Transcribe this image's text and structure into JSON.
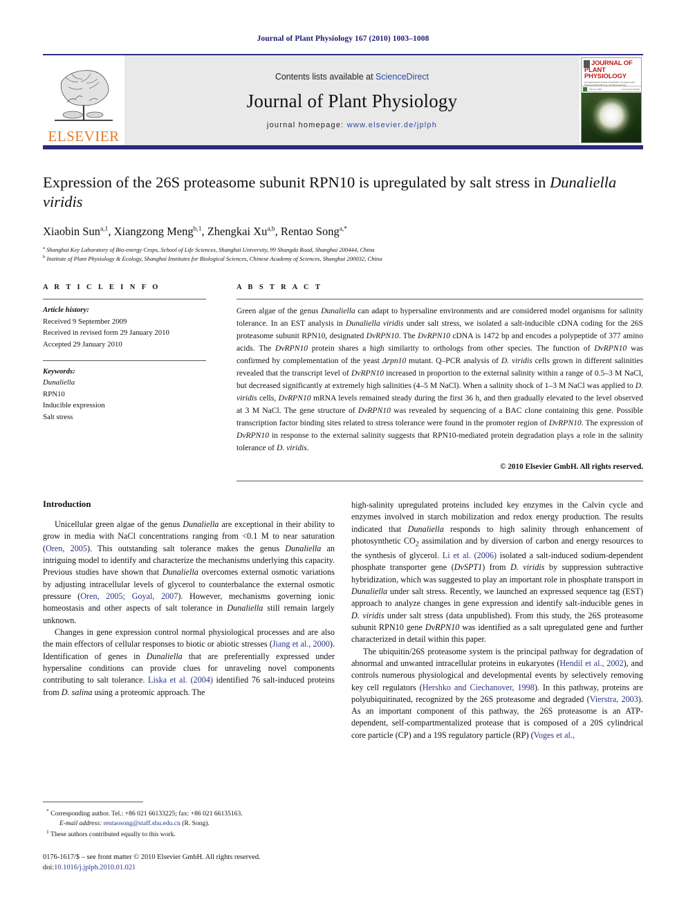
{
  "running_head": "Journal of Plant Physiology 167 (2010) 1003–1008",
  "masthead": {
    "publisher_name": "ELSEVIER",
    "publisher_logo_icon": "elsevier-tree-icon",
    "contents_prefix": "Contents lists available at ",
    "contents_link": "ScienceDirect",
    "journal_title": "Journal of Plant Physiology",
    "homepage_prefix": "journal homepage: ",
    "homepage_url": "www.elsevier.de/jplph",
    "cover": {
      "line1": "JOURNAL OF",
      "line2": "PLANT PHYSIOLOGY",
      "subline": "An International Journal of Scientific, Ecological and Functional Plant Biology and Biotechnology",
      "bar_left": "Editor-in-Chief",
      "bar_right": "www.elsevier.de/jplph",
      "image_icon": "dandelion-photo-icon"
    },
    "rule_color": "#2b2b7a"
  },
  "article": {
    "title_line1": "Expression of the 26S proteasome subunit RPN10 is upregulated by salt stress in",
    "title_italic": "Dunaliella viridis",
    "authors": [
      {
        "name": "Xiaobin Sun",
        "sup": "a,1",
        "sep": ", "
      },
      {
        "name": "Xiangzong Meng",
        "sup": "b,1",
        "sep": ", "
      },
      {
        "name": "Zhengkai Xu",
        "sup": "a,b",
        "sep": ", "
      },
      {
        "name": "Rentao Song",
        "sup": "a,*",
        "sep": ""
      }
    ],
    "affiliations": [
      {
        "marker": "a",
        "text": "Shanghai Key Laboratory of Bio-energy Crops, School of Life Sciences, Shanghai University, 99 Shangda Road, Shanghai 200444, China"
      },
      {
        "marker": "b",
        "text": "Institute of Plant Physiology & Ecology, Shanghai Institutes for Biological Sciences, Chinese Academy of Sciences, Shanghai 200032, China"
      }
    ]
  },
  "article_info": {
    "heading": "A R T I C L E    I N F O",
    "history_label": "Article history:",
    "history": [
      "Received 9 September 2009",
      "Received in revised form 29 January 2010",
      "Accepted 29 January 2010"
    ],
    "keywords_label": "Keywords:",
    "keywords": [
      {
        "text": "Dunaliella",
        "italic": true
      },
      {
        "text": "RPN10",
        "italic": false
      },
      {
        "text": "Inducible expression",
        "italic": false
      },
      {
        "text": "Salt stress",
        "italic": false
      }
    ]
  },
  "abstract": {
    "heading": "A B S T R A C T",
    "text": "Green algae of the genus Dunaliella can adapt to hypersaline environments and are considered model organisms for salinity tolerance. In an EST analysis in Dunaliella viridis under salt stress, we isolated a salt-inducible cDNA coding for the 26S proteasome subunit RPN10, designated DvRPN10. The DvRPN10 cDNA is 1472 bp and encodes a polypeptide of 377 amino acids. The DvRPN10 protein shares a high similarity to orthologs from other species. The function of DvRPN10 was confirmed by complementation of the yeast Δrpn10 mutant. Q–PCR analysis of D. viridis cells grown in different salinities revealed that the transcript level of DvRPN10 increased in proportion to the external salinity within a range of 0.5–3 M NaCl, but decreased significantly at extremely high salinities (4–5 M NaCl). When a salinity shock of 1–3 M NaCl was applied to D. viridis cells, DvRPN10 mRNA levels remained steady during the first 36 h, and then gradually elevated to the level observed at 3 M NaCl. The gene structure of DvRPN10 was revealed by sequencing of a BAC clone containing this gene. Possible transcription factor binding sites related to stress tolerance were found in the promoter region of DvRPN10. The expression of DvRPN10 in response to the external salinity suggests that RPN10-mediated protein degradation plays a role in the salinity tolerance of D. viridis.",
    "copyright": "© 2010 Elsevier GmbH. All rights reserved."
  },
  "body": {
    "section_heading": "Introduction",
    "left_paragraphs": [
      "Unicellular green algae of the genus Dunaliella are exceptional in their ability to grow in media with NaCl concentrations ranging from <0.1 M to near saturation (Oren, 2005). This outstanding salt tolerance makes the genus Dunaliella an intriguing model to identify and characterize the mechanisms underlying this capacity. Previous studies have shown that Dunaliella overcomes external osmotic variations by adjusting intracellular levels of glycerol to counterbalance the external osmotic pressure (Oren, 2005; Goyal, 2007). However, mechanisms governing ionic homeostasis and other aspects of salt tolerance in Dunaliella still remain largely unknown.",
      "Changes in gene expression control normal physiological processes and are also the main effectors of cellular responses to biotic or abiotic stresses (Jiang et al., 2000). Identification of genes in Dunaliella that are preferentially expressed under hypersaline conditions can provide clues for unraveling novel components contributing to salt tolerance. Liska et al. (2004) identified 76 salt-induced proteins from D. salina using a proteomic approach. The"
    ],
    "right_paragraphs": [
      "high-salinity upregulated proteins included key enzymes in the Calvin cycle and enzymes involved in starch mobilization and redox energy production. The results indicated that Dunaliella responds to high salinity through enhancement of photosynthetic CO2 assimilation and by diversion of carbon and energy resources to the synthesis of glycerol. Li et al. (2006) isolated a salt-induced sodium-dependent phosphate transporter gene (DvSPT1) from D. viridis by suppression subtractive hybridization, which was suggested to play an important role in phosphate transport in Dunaliella under salt stress. Recently, we launched an expressed sequence tag (EST) approach to analyze changes in gene expression and identify salt-inducible genes in D. viridis under salt stress (data unpublished). From this study, the 26S proteasome subunit RPN10 gene DvRPN10 was identified as a salt upregulated gene and further characterized in detail within this paper.",
      "The ubiquitin/26S proteasome system is the principal pathway for degradation of abnormal and unwanted intracellular proteins in eukaryotes (Hendil et al., 2002), and controls numerous physiological and developmental events by selectively removing key cell regulators (Hershko and Ciechanover, 1998). In this pathway, proteins are polyubiquitinated, recognized by the 26S proteasome and degraded (Vierstra, 2003). As an important component of this pathway, the 26S proteasome is an ATP-dependent, self-compartmentalized protease that is composed of a 20S cylindrical core particle (CP) and a 19S regulatory particle (RP) (Voges et al.,"
    ]
  },
  "footnotes": {
    "corresponding_marker": "*",
    "corresponding_text": "Corresponding author. Tel.: +86 021 66133225; fax: +86 021 66135163.",
    "email_label": "E-mail address:",
    "email": "rentaosong@staff.shu.edu.cn",
    "email_suffix": "(R. Song).",
    "equal_marker": "1",
    "equal_text": "These authors contributed equally to this work.",
    "frontmatter": "0176-1617/$ – see front matter © 2010 Elsevier GmbH. All rights reserved.",
    "doi_label": "doi:",
    "doi": "10.1016/j.jplph.2010.01.021"
  },
  "colors": {
    "link": "#27348b",
    "rule": "#2b2b7a",
    "elsevier_orange": "#E87722",
    "cover_red": "#c01a1a"
  }
}
